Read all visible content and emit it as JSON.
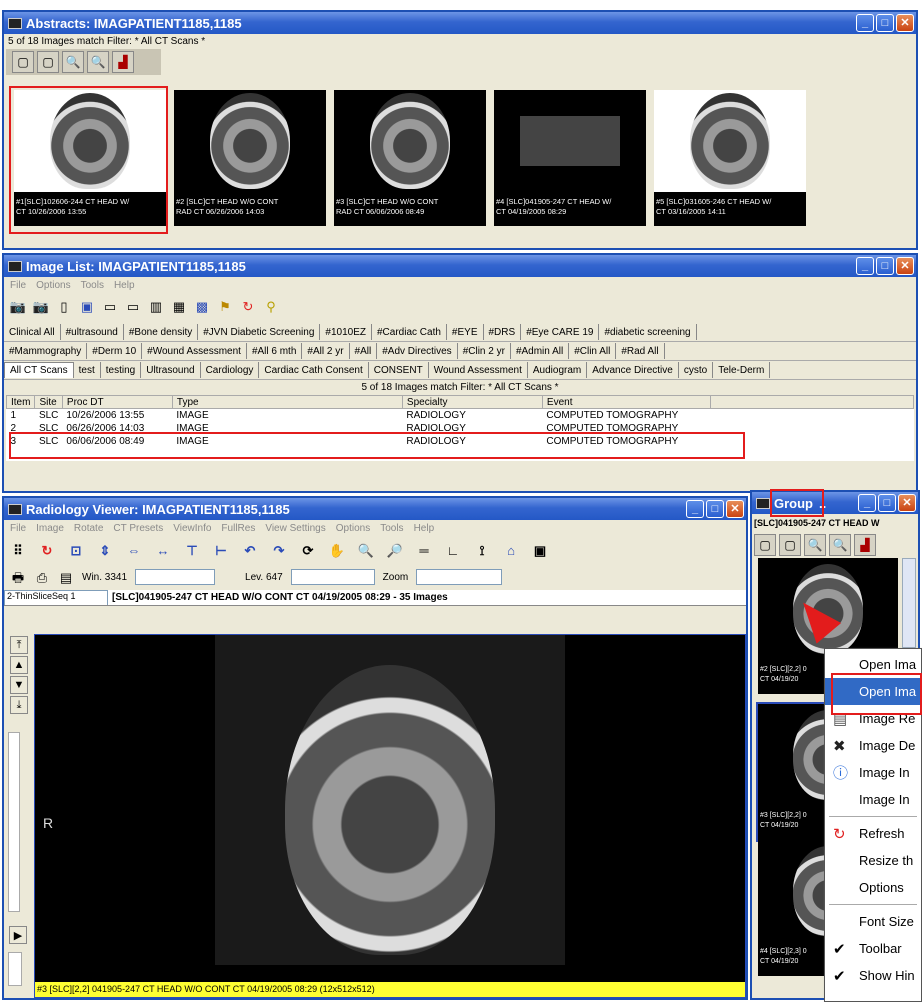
{
  "abstracts": {
    "title": "Abstracts: IMAGPATIENT1185,1185",
    "status": "5 of 18 Images match Filter: * All CT Scans *",
    "thumbs": [
      {
        "cap1": "#1[SLC]102606-244  CT HEAD W/",
        "cap2": "CT 10/26/2006 13:55"
      },
      {
        "cap1": "#2 [SLC]CT HEAD W/O CONT",
        "cap2": "RAD CT 06/26/2006 14:03"
      },
      {
        "cap1": "#3 [SLC]CT HEAD W/O CONT",
        "cap2": "RAD CT 06/06/2006 08:49"
      },
      {
        "cap1": "#4 [SLC]041905-247  CT HEAD W/",
        "cap2": "CT 04/19/2005 08:29"
      },
      {
        "cap1": "#5 [SLC]031605-246  CT HEAD W/",
        "cap2": "CT 03/16/2005 14:11"
      }
    ]
  },
  "image_list": {
    "title": "Image List: IMAGPATIENT1185,1185",
    "menu": [
      "File",
      "Options",
      "Tools",
      "Help"
    ],
    "tabs_row1": [
      "Clinical All",
      "#ultrasound",
      "#Bone density",
      "#JVN Diabetic Screening",
      "#1010EZ",
      "#Cardiac Cath",
      "#EYE",
      "#DRS",
      "#Eye CARE 19",
      "#diabetic screening"
    ],
    "tabs_row2": [
      "#Mammography",
      "#Derm 10",
      "#Wound Assessment",
      "#All 6 mth",
      "#All 2 yr",
      "#All",
      "#Adv Directives",
      "#Clin 2 yr",
      "#Admin All",
      "#Clin All",
      "#Rad All"
    ],
    "tabs_row3": [
      "All CT Scans",
      "test",
      "testing",
      "Ultrasound",
      "Cardiology",
      "Cardiac Cath Consent",
      "CONSENT",
      "Wound Assessment",
      "Audiogram",
      "Advance Directive",
      "cysto",
      "Tele-Derm"
    ],
    "status": "5 of 18 Images match Filter: * All CT Scans *",
    "columns": [
      "Item",
      "Site",
      "Proc DT",
      "Type",
      "Specialty",
      "Event"
    ],
    "rows": [
      [
        "1",
        "SLC",
        "10/26/2006 13:55",
        "IMAGE",
        "RADIOLOGY",
        "COMPUTED TOMOGRAPHY"
      ],
      [
        "2",
        "SLC",
        "06/26/2006 14:03",
        "IMAGE",
        "RADIOLOGY",
        "COMPUTED TOMOGRAPHY"
      ],
      [
        "3",
        "SLC",
        "06/06/2006 08:49",
        "IMAGE",
        "RADIOLOGY",
        "COMPUTED TOMOGRAPHY"
      ]
    ]
  },
  "viewer": {
    "title": "Radiology Viewer: IMAGPATIENT1185,1185",
    "menu": [
      "File",
      "Image",
      "Rotate",
      "CT Presets",
      "ViewInfo",
      "FullRes",
      "View Settings",
      "Options",
      "Tools",
      "Help"
    ],
    "win_label": "Win. 3341",
    "lev_label": "Lev. 647",
    "zoom_label": "Zoom",
    "series_select": "2-ThinSliceSeq 1",
    "series_header": "[SLC]041905-247  CT HEAD W/O CONT CT 04/19/2005 08:29   - 35  Images",
    "orientation_label": "R",
    "footer": "#3 [SLC][2,2] 041905-247  CT HEAD W/O CONT CT 04/19/2005 08:29 (12x512x512)"
  },
  "group": {
    "title": "Group",
    "header": "[SLC]041905-247  CT HEAD W",
    "thumb_caps": [
      {
        "cap1": "#2 [SLC][2,2] 0",
        "cap2": "CT 04/19/20"
      },
      {
        "cap1": "#3 [SLC][2,2] 0",
        "cap2": "CT 04/19/20"
      },
      {
        "cap1": "#4 [SLC][2,3] 0",
        "cap2": "CT 04/19/20"
      }
    ]
  },
  "context_menu": {
    "items": [
      {
        "label": "Open Ima",
        "icon": "",
        "sep_after": false
      },
      {
        "label": "Open Ima",
        "icon": "",
        "sep_after": false,
        "highlighted": true
      },
      {
        "label": "Image Re",
        "icon": "image-report-icon",
        "sep_after": false
      },
      {
        "label": "Image De",
        "icon": "delete-x-icon",
        "sep_after": false
      },
      {
        "label": "Image In",
        "icon": "info-icon",
        "sep_after": false
      },
      {
        "label": "Image In",
        "icon": "",
        "sep_after": true
      },
      {
        "label": "Refresh",
        "icon": "refresh-icon",
        "sep_after": false
      },
      {
        "label": "Resize th",
        "icon": "",
        "sep_after": false
      },
      {
        "label": "Options",
        "icon": "",
        "sep_after": true
      },
      {
        "label": "Font Size",
        "icon": "",
        "sep_after": false
      },
      {
        "label": "Toolbar",
        "icon": "checkmark-icon",
        "sep_after": false
      },
      {
        "label": "Show Hin",
        "icon": "checkmark-icon",
        "sep_after": false
      }
    ]
  },
  "colors": {
    "titlebar": "#2458c6",
    "highlight_red": "#e31c1c",
    "selection_blue": "#316ac5",
    "footer_yellow": "#ffff33"
  }
}
